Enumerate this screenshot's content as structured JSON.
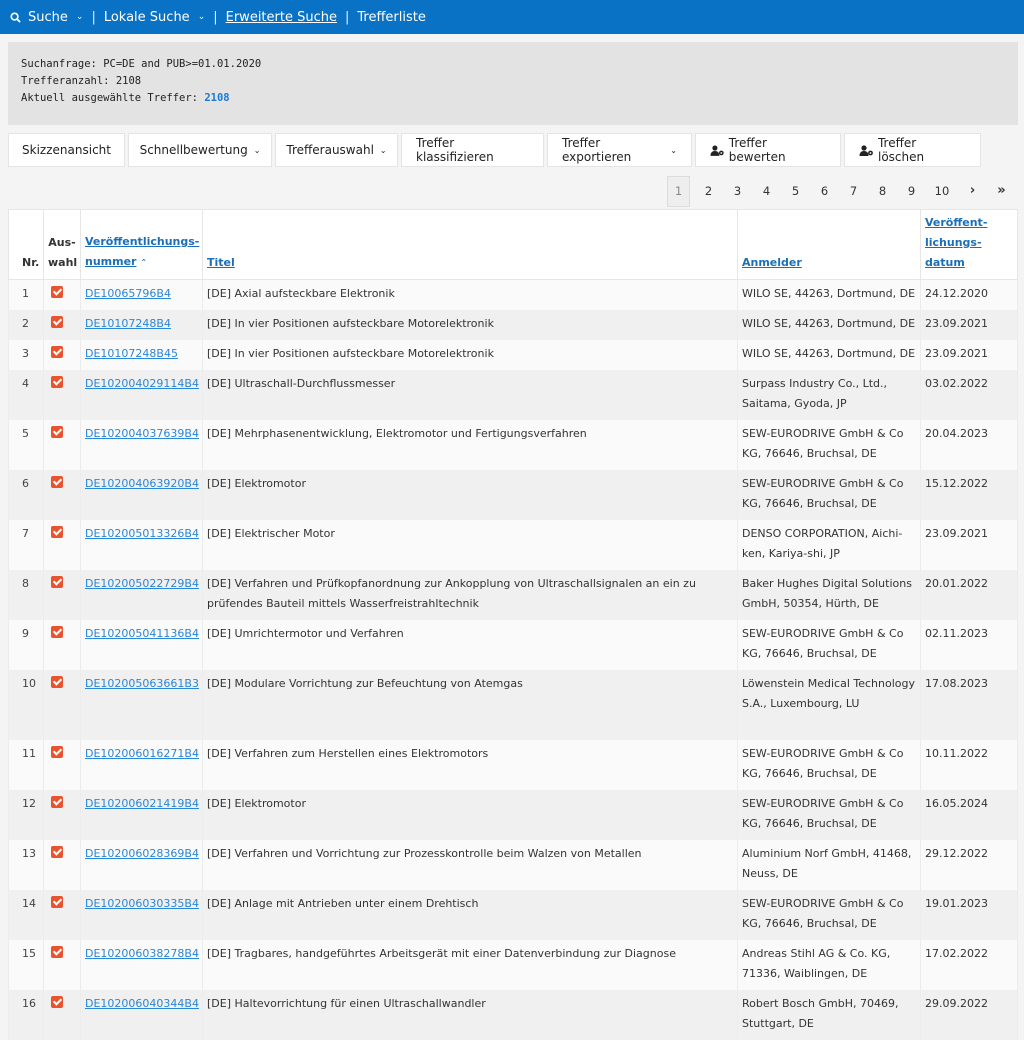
{
  "nav": {
    "search": "Suche",
    "local_search": "Lokale Suche",
    "advanced_search": "Erweiterte Suche",
    "hitlist": "Trefferliste"
  },
  "info": {
    "query_label": "Suchanfrage:",
    "query_value": "PC=DE and PUB>=01.01.2020",
    "count_label": "Trefferanzahl:",
    "count_value": "2108",
    "selected_label": "Aktuell ausgewählte Treffer:",
    "selected_value": "2108"
  },
  "toolbar": {
    "sketch": "Skizzenansicht",
    "quick_rating": "Schnellbewertung",
    "hit_selection": "Trefferauswahl",
    "classify": "Treffer klassifizieren",
    "export": "Treffer exportieren",
    "rate": "Treffer bewerten",
    "delete": "Treffer löschen"
  },
  "pager": [
    "1",
    "2",
    "3",
    "4",
    "5",
    "6",
    "7",
    "8",
    "9",
    "10"
  ],
  "pager_active": "1",
  "table": {
    "headers": {
      "nr": "Nr.",
      "sel_1": "Aus-",
      "sel_2": "wahl",
      "pubnum_1": "Veröffentlichungs-",
      "pubnum_2": "nummer",
      "title": "Titel",
      "applicant": "Anmelder",
      "date_1": "Veröffent-",
      "date_2": "lichungs-",
      "date_3": "datum"
    },
    "rows": [
      {
        "nr": "1",
        "pubnum": "DE10065796B4",
        "title": "[DE] Axial aufsteckbare Elektronik",
        "applicant": "WILO SE, 44263, Dortmund, DE",
        "date": "24.12.2020"
      },
      {
        "nr": "2",
        "pubnum": "DE10107248B4",
        "title": "[DE] In vier Positionen aufsteckbare Motorelektronik",
        "applicant": "WILO SE, 44263, Dortmund, DE",
        "date": "23.09.2021"
      },
      {
        "nr": "3",
        "pubnum": "DE10107248B45",
        "title": "[DE] In vier Positionen aufsteckbare Motorelektronik",
        "applicant": "WILO SE, 44263, Dortmund, DE",
        "date": "23.09.2021"
      },
      {
        "nr": "4",
        "pubnum": "DE102004029114B4",
        "title": "[DE] Ultraschall-Durchflussmesser",
        "applicant": "Surpass Industry Co., Ltd., Saitama, Gyoda, JP",
        "date": "03.02.2022"
      },
      {
        "nr": "5",
        "pubnum": "DE102004037639B4",
        "title": "[DE] Mehrphasenentwicklung, Elektromotor und Fertigungsverfahren",
        "applicant": "SEW-EURODRIVE GmbH & Co KG, 76646, Bruchsal, DE",
        "date": "20.04.2023"
      },
      {
        "nr": "6",
        "pubnum": "DE102004063920B4",
        "title": "[DE] Elektromotor",
        "applicant": "SEW-EURODRIVE GmbH & Co KG, 76646, Bruchsal, DE",
        "date": "15.12.2022"
      },
      {
        "nr": "7",
        "pubnum": "DE102005013326B4",
        "title": "[DE] Elektrischer Motor",
        "applicant": "DENSO CORPORATION, Aichi-ken, Kariya-shi, JP",
        "date": "23.09.2021"
      },
      {
        "nr": "8",
        "pubnum": "DE102005022729B4",
        "title": "[DE] Verfahren und Prüfkopfanordnung zur Ankopplung von Ultraschallsignalen an ein zu prüfendes Bauteil mittels Wasserfreistrahltechnik",
        "applicant": "Baker Hughes Digital Solutions GmbH, 50354, Hürth, DE",
        "date": "20.01.2022"
      },
      {
        "nr": "9",
        "pubnum": "DE102005041136B4",
        "title": "[DE] Umrichtermotor und Verfahren",
        "applicant": "SEW-EURODRIVE GmbH & Co KG, 76646, Bruchsal, DE",
        "date": "02.11.2023"
      },
      {
        "nr": "10",
        "pubnum": "DE102005063661B3",
        "title": "[DE] Modulare Vorrichtung zur Befeuchtung von Atemgas",
        "applicant": "Löwenstein Medical Technology S.A., Luxembourg, LU",
        "date": "17.08.2023"
      },
      {
        "nr": "11",
        "pubnum": "DE102006016271B4",
        "title": "[DE] Verfahren zum Herstellen eines Elektromotors",
        "applicant": "SEW-EURODRIVE GmbH & Co KG, 76646, Bruchsal, DE",
        "date": "10.11.2022"
      },
      {
        "nr": "12",
        "pubnum": "DE102006021419B4",
        "title": "[DE] Elektromotor",
        "applicant": "SEW-EURODRIVE GmbH & Co KG, 76646, Bruchsal, DE",
        "date": "16.05.2024"
      },
      {
        "nr": "13",
        "pubnum": "DE102006028369B4",
        "title": "[DE] Verfahren und Vorrichtung zur Prozesskontrolle beim Walzen von Metallen",
        "applicant": "Aluminium Norf GmbH, 41468, Neuss, DE",
        "date": "29.12.2022"
      },
      {
        "nr": "14",
        "pubnum": "DE102006030335B4",
        "title": "[DE] Anlage mit Antrieben unter einem Drehtisch",
        "applicant": "SEW-EURODRIVE GmbH & Co KG, 76646, Bruchsal, DE",
        "date": "19.01.2023"
      },
      {
        "nr": "15",
        "pubnum": "DE102006038278B4",
        "title": "[DE] Tragbares, handgeführtes Arbeitsgerät mit einer Datenverbindung zur Diagnose",
        "applicant": "Andreas Stihl AG & Co. KG, 71336, Waiblingen, DE",
        "date": "17.02.2022"
      },
      {
        "nr": "16",
        "pubnum": "DE102006040344B4",
        "title": "[DE] Haltevorrichtung für einen Ultraschallwandler",
        "applicant": "Robert Bosch GmbH, 70469, Stuttgart, DE",
        "date": "29.09.2022"
      }
    ]
  }
}
